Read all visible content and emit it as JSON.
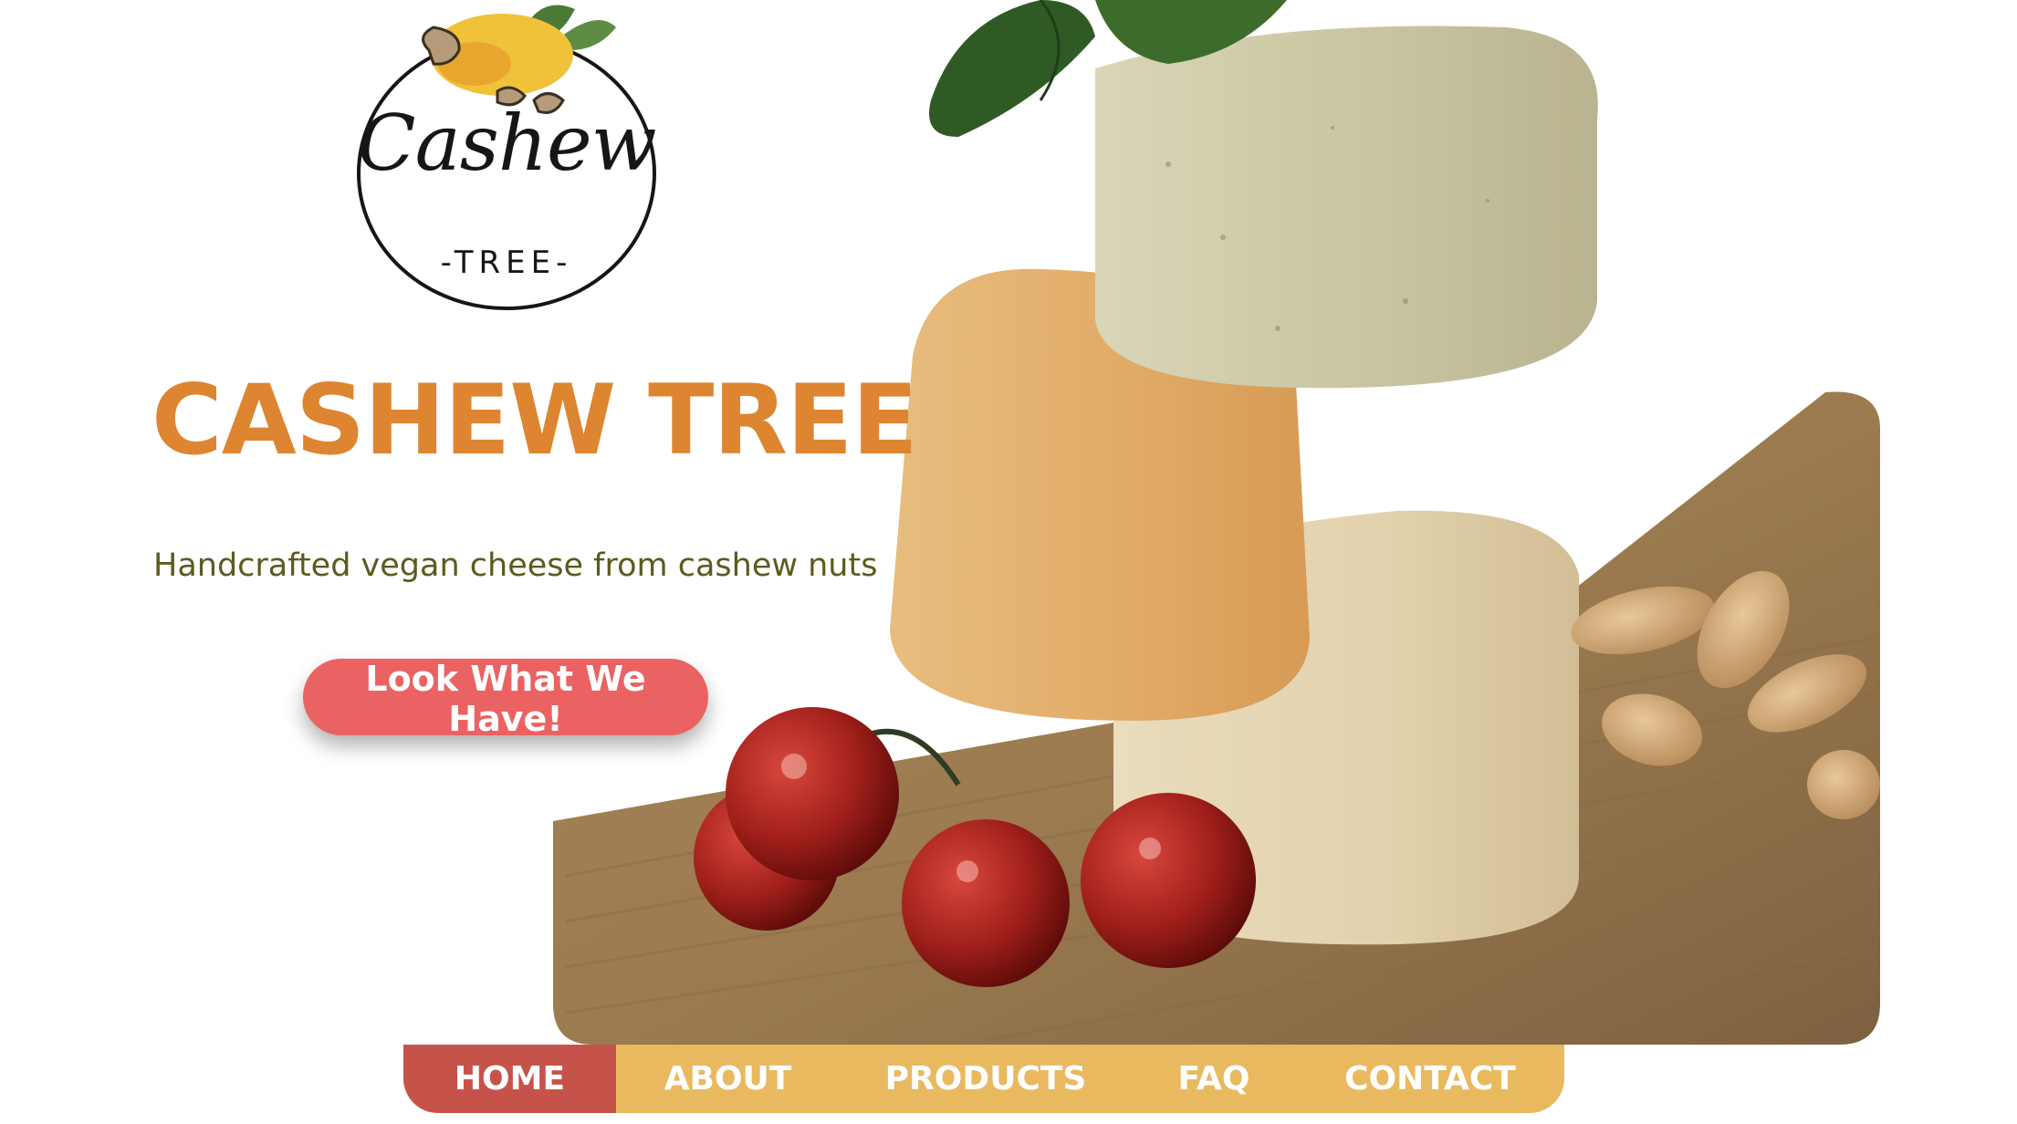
{
  "brand": {
    "logo_word": "Cashew",
    "logo_sub": "-TREE-",
    "title": "CASHEW TREE",
    "tagline": "Handcrafted vegan cheese from cashew nuts"
  },
  "cta": {
    "label": "Look What We Have!"
  },
  "nav": {
    "items": [
      {
        "label": "HOME",
        "active": true
      },
      {
        "label": "ABOUT",
        "active": false
      },
      {
        "label": "PRODUCTS",
        "active": false
      },
      {
        "label": "FAQ",
        "active": false
      },
      {
        "label": "CONTACT",
        "active": false
      }
    ]
  },
  "colors": {
    "headline": "#dd8530",
    "tagline": "#5c5a1e",
    "cta": "#ea6262",
    "nav_bg": "#e9b960",
    "nav_active": "#c6534a"
  },
  "icons": {
    "logo": "cashew-fruit-logo-icon"
  }
}
